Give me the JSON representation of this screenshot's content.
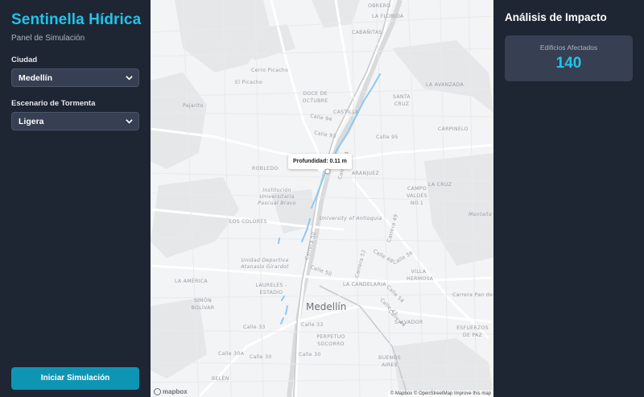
{
  "sidebar": {
    "title": "Sentinella Hídrica",
    "subtitle": "Panel de Simulación",
    "city_label": "Ciudad",
    "city_value": "Medellín",
    "storm_label": "Escenario de Tormenta",
    "storm_value": "Ligera",
    "run_button": "Iniciar Simulación"
  },
  "map": {
    "tooltip": "Profundidad: 0.11 m",
    "logo": "mapbox",
    "attribution": "© Mapbox © OpenStreetMap Improve this map",
    "labels": {
      "obrero": "OBRERO",
      "la_florida": "LA FLORIDA",
      "cabanitas": "CABAÑITAS",
      "cerro_picacho": "Cerro Picacho",
      "el_picacho": "El Picacho",
      "doce_de_octubre": "DOCE DE OCTUBRE",
      "santa_cruz": "SANTA CRUZ",
      "castilla": "CASTILLA",
      "pajarito": "Pajarito",
      "la_avanzada": "LA AVANZADA",
      "calle_94": "Calle 94",
      "carpinelo": "CARPINELO",
      "calle_93": "Calle 93",
      "calle_95": "Calle 95",
      "robledo": "ROBLEDO",
      "aranjuez": "ARANJUEZ",
      "la_cruz": "LA CRUZ",
      "campo_valdes": "CAMPO VALDÉS NO.1",
      "institucion": "Institución Universitaria Pascual Bravo",
      "carrera_64": "Carrera 64",
      "univ_antioquia": "University of Antioquia",
      "carrera_49": "Carrera 49",
      "los_colores": "LOS COLORES",
      "montana": "Montaña",
      "carrera_52": "Carrera 52",
      "carrera_50": "Carrera 50",
      "unidad_deportiva": "Unidad Deportiva Atanasio Girardot",
      "calle_48": "Calle 48",
      "calle_56": "Calle 56",
      "villa_hermosa": "VILLA HERMOSA",
      "calle_50": "Calle 50",
      "la_america": "LA AMÉRICA",
      "laureles": "LAURELES - ESTADIO",
      "la_candelaria": "LA CANDELARIA",
      "calle_54": "Calle 54",
      "simon_bolivar": "SIMÓN BOLÍVAR",
      "medellin": "Medellín",
      "calle_47": "Calle 47",
      "carrera_pan_de": "Carrera Pan de",
      "calle_44": "Calle 44",
      "calle_33": "Calle 33",
      "calle_33b": "Calle 33",
      "salvador": "SALVADOR",
      "esfuerzos_de_paz": "ESFUERZOS DE PAZ",
      "perpetuo_socorro": "PERPETUO SOCORRO",
      "calle_30a": "Calle 30A",
      "calle_30": "Calle 30",
      "calle_30b": "Calle 30",
      "buenos_aires": "BUENOS AIRES",
      "belen": "BELÉN"
    }
  },
  "impact": {
    "title": "Análisis de Impacto",
    "buildings_label": "Edificios Afectados",
    "buildings_value": "140"
  },
  "colors": {
    "background": "#1e2533",
    "accent": "#22c3ea",
    "card": "#364052",
    "button": "#0e95b4",
    "flood": "#8ec8ee"
  }
}
